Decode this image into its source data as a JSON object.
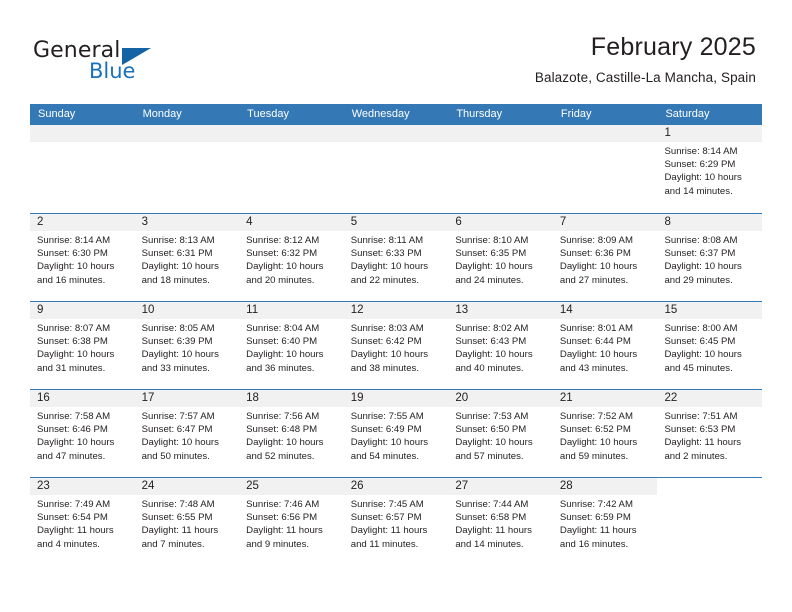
{
  "brand": {
    "name_part1": "General",
    "name_part2": "Blue"
  },
  "header": {
    "month_title": "February 2025",
    "location": "Balazote, Castille-La Mancha, Spain"
  },
  "colors": {
    "header_blue": "#3479b6",
    "brand_blue": "#1a72ba",
    "date_band": "#f1f1f1",
    "text": "#231f20"
  },
  "weekday_headers": [
    "Sunday",
    "Monday",
    "Tuesday",
    "Wednesday",
    "Thursday",
    "Friday",
    "Saturday"
  ],
  "weeks": [
    [
      {
        "day": "",
        "blank": true
      },
      {
        "day": "",
        "blank": true
      },
      {
        "day": "",
        "blank": true
      },
      {
        "day": "",
        "blank": true
      },
      {
        "day": "",
        "blank": true
      },
      {
        "day": "",
        "blank": true
      },
      {
        "day": "1",
        "sunrise": "Sunrise: 8:14 AM",
        "sunset": "Sunset: 6:29 PM",
        "daylight_line1": "Daylight: 10 hours",
        "daylight_line2": "and 14 minutes."
      }
    ],
    [
      {
        "day": "2",
        "sunrise": "Sunrise: 8:14 AM",
        "sunset": "Sunset: 6:30 PM",
        "daylight_line1": "Daylight: 10 hours",
        "daylight_line2": "and 16 minutes."
      },
      {
        "day": "3",
        "sunrise": "Sunrise: 8:13 AM",
        "sunset": "Sunset: 6:31 PM",
        "daylight_line1": "Daylight: 10 hours",
        "daylight_line2": "and 18 minutes."
      },
      {
        "day": "4",
        "sunrise": "Sunrise: 8:12 AM",
        "sunset": "Sunset: 6:32 PM",
        "daylight_line1": "Daylight: 10 hours",
        "daylight_line2": "and 20 minutes."
      },
      {
        "day": "5",
        "sunrise": "Sunrise: 8:11 AM",
        "sunset": "Sunset: 6:33 PM",
        "daylight_line1": "Daylight: 10 hours",
        "daylight_line2": "and 22 minutes."
      },
      {
        "day": "6",
        "sunrise": "Sunrise: 8:10 AM",
        "sunset": "Sunset: 6:35 PM",
        "daylight_line1": "Daylight: 10 hours",
        "daylight_line2": "and 24 minutes."
      },
      {
        "day": "7",
        "sunrise": "Sunrise: 8:09 AM",
        "sunset": "Sunset: 6:36 PM",
        "daylight_line1": "Daylight: 10 hours",
        "daylight_line2": "and 27 minutes."
      },
      {
        "day": "8",
        "sunrise": "Sunrise: 8:08 AM",
        "sunset": "Sunset: 6:37 PM",
        "daylight_line1": "Daylight: 10 hours",
        "daylight_line2": "and 29 minutes."
      }
    ],
    [
      {
        "day": "9",
        "sunrise": "Sunrise: 8:07 AM",
        "sunset": "Sunset: 6:38 PM",
        "daylight_line1": "Daylight: 10 hours",
        "daylight_line2": "and 31 minutes."
      },
      {
        "day": "10",
        "sunrise": "Sunrise: 8:05 AM",
        "sunset": "Sunset: 6:39 PM",
        "daylight_line1": "Daylight: 10 hours",
        "daylight_line2": "and 33 minutes."
      },
      {
        "day": "11",
        "sunrise": "Sunrise: 8:04 AM",
        "sunset": "Sunset: 6:40 PM",
        "daylight_line1": "Daylight: 10 hours",
        "daylight_line2": "and 36 minutes."
      },
      {
        "day": "12",
        "sunrise": "Sunrise: 8:03 AM",
        "sunset": "Sunset: 6:42 PM",
        "daylight_line1": "Daylight: 10 hours",
        "daylight_line2": "and 38 minutes."
      },
      {
        "day": "13",
        "sunrise": "Sunrise: 8:02 AM",
        "sunset": "Sunset: 6:43 PM",
        "daylight_line1": "Daylight: 10 hours",
        "daylight_line2": "and 40 minutes."
      },
      {
        "day": "14",
        "sunrise": "Sunrise: 8:01 AM",
        "sunset": "Sunset: 6:44 PM",
        "daylight_line1": "Daylight: 10 hours",
        "daylight_line2": "and 43 minutes."
      },
      {
        "day": "15",
        "sunrise": "Sunrise: 8:00 AM",
        "sunset": "Sunset: 6:45 PM",
        "daylight_line1": "Daylight: 10 hours",
        "daylight_line2": "and 45 minutes."
      }
    ],
    [
      {
        "day": "16",
        "sunrise": "Sunrise: 7:58 AM",
        "sunset": "Sunset: 6:46 PM",
        "daylight_line1": "Daylight: 10 hours",
        "daylight_line2": "and 47 minutes."
      },
      {
        "day": "17",
        "sunrise": "Sunrise: 7:57 AM",
        "sunset": "Sunset: 6:47 PM",
        "daylight_line1": "Daylight: 10 hours",
        "daylight_line2": "and 50 minutes."
      },
      {
        "day": "18",
        "sunrise": "Sunrise: 7:56 AM",
        "sunset": "Sunset: 6:48 PM",
        "daylight_line1": "Daylight: 10 hours",
        "daylight_line2": "and 52 minutes."
      },
      {
        "day": "19",
        "sunrise": "Sunrise: 7:55 AM",
        "sunset": "Sunset: 6:49 PM",
        "daylight_line1": "Daylight: 10 hours",
        "daylight_line2": "and 54 minutes."
      },
      {
        "day": "20",
        "sunrise": "Sunrise: 7:53 AM",
        "sunset": "Sunset: 6:50 PM",
        "daylight_line1": "Daylight: 10 hours",
        "daylight_line2": "and 57 minutes."
      },
      {
        "day": "21",
        "sunrise": "Sunrise: 7:52 AM",
        "sunset": "Sunset: 6:52 PM",
        "daylight_line1": "Daylight: 10 hours",
        "daylight_line2": "and 59 minutes."
      },
      {
        "day": "22",
        "sunrise": "Sunrise: 7:51 AM",
        "sunset": "Sunset: 6:53 PM",
        "daylight_line1": "Daylight: 11 hours",
        "daylight_line2": "and 2 minutes."
      }
    ],
    [
      {
        "day": "23",
        "sunrise": "Sunrise: 7:49 AM",
        "sunset": "Sunset: 6:54 PM",
        "daylight_line1": "Daylight: 11 hours",
        "daylight_line2": "and 4 minutes."
      },
      {
        "day": "24",
        "sunrise": "Sunrise: 7:48 AM",
        "sunset": "Sunset: 6:55 PM",
        "daylight_line1": "Daylight: 11 hours",
        "daylight_line2": "and 7 minutes."
      },
      {
        "day": "25",
        "sunrise": "Sunrise: 7:46 AM",
        "sunset": "Sunset: 6:56 PM",
        "daylight_line1": "Daylight: 11 hours",
        "daylight_line2": "and 9 minutes."
      },
      {
        "day": "26",
        "sunrise": "Sunrise: 7:45 AM",
        "sunset": "Sunset: 6:57 PM",
        "daylight_line1": "Daylight: 11 hours",
        "daylight_line2": "and 11 minutes."
      },
      {
        "day": "27",
        "sunrise": "Sunrise: 7:44 AM",
        "sunset": "Sunset: 6:58 PM",
        "daylight_line1": "Daylight: 11 hours",
        "daylight_line2": "and 14 minutes."
      },
      {
        "day": "28",
        "sunrise": "Sunrise: 7:42 AM",
        "sunset": "Sunset: 6:59 PM",
        "daylight_line1": "Daylight: 11 hours",
        "daylight_line2": "and 16 minutes."
      },
      {
        "day": "",
        "empty": true
      }
    ]
  ]
}
